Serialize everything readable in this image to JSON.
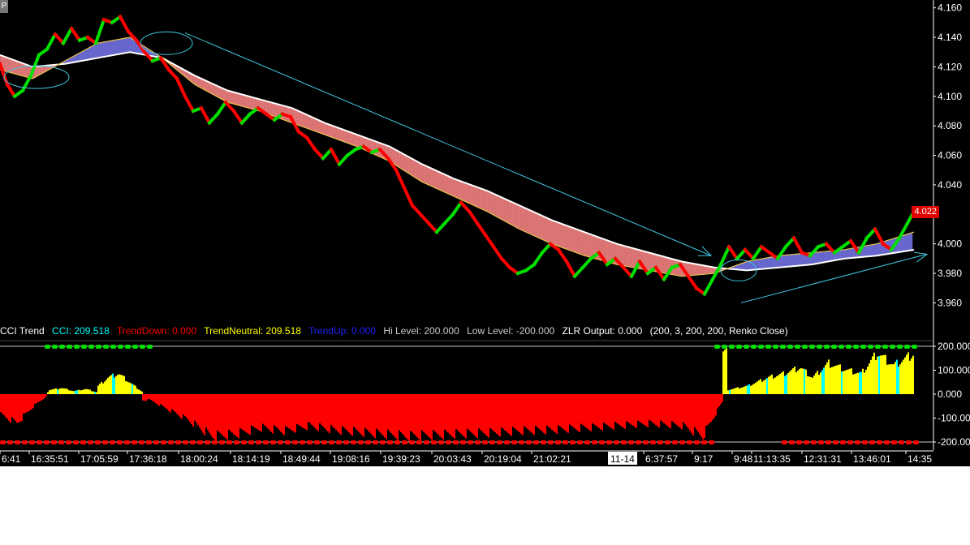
{
  "title_strip": "P",
  "indicator_legend": {
    "name": "CCI Trend",
    "cci": "CCI: 209.518",
    "trend_down": "TrendDown: 0.000",
    "trend_neutral": "TrendNeutral: 209.518",
    "trend_up": "TrendUp: 0.000",
    "hi_level": "Hi Level: 200.000",
    "low_level": "Low Level: -200.000",
    "zlr_output": "ZLR Output: 0.000",
    "params": "(200, 3, 200, 200, Renko Close)"
  },
  "colors": {
    "background": "#000000",
    "up_brick": "#00e000",
    "down_brick": "#ff0000",
    "ribbon_bear": "#f08080",
    "ribbon_bull": "#7070e0",
    "ma_white": "#ffffff",
    "ma_yellow": "#e8c24a",
    "trendline": "#40c8e0",
    "cci_pos": "#ffff00",
    "cci_neg": "#ff0000",
    "cci_cyan": "#00ffff"
  },
  "chart_data": [
    {
      "type": "line",
      "subtype": "renko",
      "x_tick_labels": [
        "6:41",
        "16:35:51",
        "17:05:59",
        "17:36:18",
        "18:00:24",
        "18:14:19",
        "18:49:44",
        "19:08:16",
        "19:39:23",
        "20:03:43",
        "20:19:04",
        "21:02:21",
        "11-14",
        "6:37:57",
        "9:17",
        "9:48",
        "11:13:35",
        "12:31:31",
        "13:46:01",
        "14:35"
      ],
      "y_tick_labels": [
        "4.160",
        "4.140",
        "4.120",
        "4.100",
        "4.080",
        "4.060",
        "4.040",
        "4.022",
        "4.000",
        "3.980",
        "3.960"
      ],
      "ylim": [
        3.952,
        4.162
      ],
      "last_price": "4.022",
      "series": [
        {
          "kind": "renko-close",
          "points": [
            [
              0,
              4.122
            ],
            [
              9,
              4.108
            ],
            [
              18,
              4.1
            ],
            [
              28,
              4.104
            ],
            [
              38,
              4.114
            ],
            [
              48,
              4.128
            ],
            [
              58,
              4.132
            ],
            [
              68,
              4.142
            ],
            [
              78,
              4.136
            ],
            [
              88,
              4.146
            ],
            [
              98,
              4.138
            ],
            [
              108,
              4.14
            ],
            [
              118,
              4.136
            ],
            [
              128,
              4.152
            ],
            [
              138,
              4.15
            ],
            [
              148,
              4.154
            ],
            [
              158,
              4.144
            ],
            [
              168,
              4.138
            ],
            [
              178,
              4.13
            ],
            [
              188,
              4.124
            ],
            [
              198,
              4.126
            ],
            [
              208,
              4.118
            ],
            [
              218,
              4.112
            ],
            [
              228,
              4.1
            ],
            [
              238,
              4.09
            ],
            [
              248,
              4.092
            ],
            [
              258,
              4.082
            ],
            [
              268,
              4.088
            ],
            [
              278,
              4.096
            ],
            [
              288,
              4.09
            ],
            [
              298,
              4.082
            ],
            [
              308,
              4.088
            ],
            [
              318,
              4.092
            ],
            [
              328,
              4.088
            ],
            [
              338,
              4.084
            ],
            [
              348,
              4.088
            ],
            [
              358,
              4.086
            ],
            [
              368,
              4.076
            ],
            [
              378,
              4.072
            ],
            [
              388,
              4.064
            ],
            [
              398,
              4.058
            ],
            [
              408,
              4.064
            ],
            [
              418,
              4.054
            ],
            [
              428,
              4.06
            ],
            [
              438,
              4.064
            ],
            [
              448,
              4.066
            ],
            [
              458,
              4.062
            ],
            [
              468,
              4.064
            ],
            [
              478,
              4.058
            ],
            [
              488,
              4.05
            ],
            [
              498,
              4.038
            ],
            [
              508,
              4.026
            ],
            [
              518,
              4.02
            ],
            [
              528,
              4.014
            ],
            [
              538,
              4.008
            ],
            [
              548,
              4.014
            ],
            [
              558,
              4.02
            ],
            [
              568,
              4.028
            ],
            [
              578,
              4.022
            ],
            [
              588,
              4.014
            ],
            [
              598,
              4.006
            ],
            [
              608,
              3.998
            ],
            [
              618,
              3.99
            ],
            [
              628,
              3.984
            ],
            [
              638,
              3.98
            ],
            [
              648,
              3.982
            ],
            [
              658,
              3.986
            ],
            [
              668,
              3.994
            ],
            [
              678,
              4.0
            ],
            [
              688,
              3.996
            ],
            [
              698,
              3.988
            ],
            [
              708,
              3.978
            ],
            [
              718,
              3.984
            ],
            [
              728,
              3.99
            ],
            [
              738,
              3.994
            ],
            [
              748,
              3.986
            ],
            [
              758,
              3.99
            ],
            [
              768,
              3.984
            ],
            [
              778,
              3.978
            ],
            [
              788,
              3.988
            ],
            [
              798,
              3.98
            ],
            [
              808,
              3.984
            ],
            [
              818,
              3.976
            ],
            [
              828,
              3.984
            ],
            [
              838,
              3.986
            ],
            [
              848,
              3.978
            ],
            [
              858,
              3.97
            ],
            [
              868,
              3.966
            ],
            [
              878,
              3.976
            ],
            [
              888,
              3.986
            ],
            [
              898,
              3.998
            ],
            [
              908,
              3.99
            ],
            [
              918,
              3.996
            ],
            [
              928,
              3.99
            ],
            [
              938,
              3.998
            ],
            [
              948,
              3.994
            ],
            [
              958,
              3.99
            ],
            [
              968,
              3.998
            ],
            [
              978,
              4.004
            ],
            [
              988,
              3.994
            ],
            [
              998,
              3.992
            ],
            [
              1008,
              3.998
            ],
            [
              1018,
              4.0
            ],
            [
              1028,
              3.994
            ],
            [
              1038,
              3.998
            ],
            [
              1048,
              4.002
            ],
            [
              1058,
              3.994
            ],
            [
              1068,
              4.004
            ],
            [
              1078,
              4.01
            ],
            [
              1088,
              4.0
            ],
            [
              1098,
              3.996
            ],
            [
              1108,
              4.004
            ],
            [
              1118,
              4.014
            ],
            [
              1126,
              4.022
            ]
          ]
        },
        {
          "kind": "ma-white",
          "points": [
            [
              0,
              4.128
            ],
            [
              40,
              4.12
            ],
            [
              80,
              4.122
            ],
            [
              120,
              4.126
            ],
            [
              160,
              4.13
            ],
            [
              200,
              4.126
            ],
            [
              240,
              4.114
            ],
            [
              280,
              4.104
            ],
            [
              320,
              4.098
            ],
            [
              360,
              4.092
            ],
            [
              400,
              4.082
            ],
            [
              440,
              4.074
            ],
            [
              480,
              4.066
            ],
            [
              520,
              4.054
            ],
            [
              560,
              4.044
            ],
            [
              600,
              4.036
            ],
            [
              640,
              4.026
            ],
            [
              680,
              4.016
            ],
            [
              720,
              4.008
            ],
            [
              760,
              4.0
            ],
            [
              800,
              3.994
            ],
            [
              840,
              3.988
            ],
            [
              880,
              3.984
            ],
            [
              920,
              3.982
            ],
            [
              960,
              3.984
            ],
            [
              1000,
              3.986
            ],
            [
              1040,
              3.99
            ],
            [
              1080,
              3.992
            ],
            [
              1126,
              3.996
            ]
          ]
        },
        {
          "kind": "ma-fast",
          "points": [
            [
              0,
              4.118
            ],
            [
              40,
              4.112
            ],
            [
              80,
              4.124
            ],
            [
              120,
              4.136
            ],
            [
              160,
              4.14
            ],
            [
              200,
              4.126
            ],
            [
              240,
              4.108
            ],
            [
              280,
              4.096
            ],
            [
              320,
              4.09
            ],
            [
              360,
              4.082
            ],
            [
              400,
              4.074
            ],
            [
              440,
              4.066
            ],
            [
              480,
              4.056
            ],
            [
              520,
              4.042
            ],
            [
              560,
              4.032
            ],
            [
              600,
              4.022
            ],
            [
              640,
              4.01
            ],
            [
              680,
              4.0
            ],
            [
              720,
              3.992
            ],
            [
              760,
              3.986
            ],
            [
              800,
              3.982
            ],
            [
              840,
              3.978
            ],
            [
              880,
              3.98
            ],
            [
              920,
              3.988
            ],
            [
              960,
              3.992
            ],
            [
              1000,
              3.994
            ],
            [
              1040,
              3.996
            ],
            [
              1080,
              4.0
            ],
            [
              1126,
              4.008
            ]
          ]
        }
      ],
      "trendlines": [
        {
          "from": [
            228,
            4.143
          ],
          "to": [
            876,
            3.992
          ]
        },
        {
          "from": [
            913,
            3.96
          ],
          "to": [
            1142,
            3.993
          ]
        }
      ]
    },
    {
      "type": "bar",
      "title": "CCI Trend",
      "y_tick_labels": [
        "200.000",
        "100.000",
        "0.000",
        "-100.000",
        "-200.000"
      ],
      "ylim": [
        -210,
        210
      ],
      "x_range": [
        0,
        1126
      ],
      "segments": [
        {
          "x0": 0,
          "x1": 58,
          "kind": "neg",
          "peaks": [
            [
              0,
              -100
            ],
            [
              20,
              -140
            ],
            [
              40,
              -60
            ],
            [
              58,
              -5
            ]
          ]
        },
        {
          "x0": 58,
          "x1": 118,
          "kind": "pos",
          "peaks": [
            [
              60,
              20
            ],
            [
              75,
              30
            ],
            [
              90,
              15
            ],
            [
              105,
              25
            ],
            [
              118,
              10
            ]
          ]
        },
        {
          "x0": 118,
          "x1": 175,
          "kind": "pos",
          "peaks": [
            [
              120,
              40
            ],
            [
              132,
              80
            ],
            [
              145,
              100
            ],
            [
              158,
              60
            ],
            [
              168,
              30
            ],
            [
              175,
              10
            ]
          ]
        },
        {
          "x0": 175,
          "x1": 890,
          "kind": "neg",
          "peaks": [
            [
              180,
              -20
            ],
            [
              200,
              -60
            ],
            [
              230,
              -120
            ],
            [
              260,
              -200
            ],
            [
              290,
              -190
            ],
            [
              320,
              -160
            ],
            [
              350,
              -175
            ],
            [
              380,
              -150
            ],
            [
              410,
              -170
            ],
            [
              440,
              -180
            ],
            [
              470,
              -190
            ],
            [
              500,
              -200
            ],
            [
              530,
              -195
            ],
            [
              560,
              -190
            ],
            [
              600,
              -185
            ],
            [
              640,
              -175
            ],
            [
              680,
              -170
            ],
            [
              720,
              -160
            ],
            [
              760,
              -150
            ],
            [
              800,
              -140
            ],
            [
              840,
              -150
            ],
            [
              865,
              -200
            ],
            [
              890,
              -30
            ]
          ]
        },
        {
          "x0": 890,
          "x1": 1126,
          "kind": "pos",
          "peaks": [
            [
              895,
              20
            ],
            [
              920,
              40
            ],
            [
              945,
              80
            ],
            [
              965,
              100
            ],
            [
              985,
              130
            ],
            [
              1000,
              80
            ],
            [
              1020,
              150
            ],
            [
              1040,
              120
            ],
            [
              1060,
              100
            ],
            [
              1080,
              200
            ],
            [
              1100,
              140
            ],
            [
              1126,
              200
            ]
          ]
        }
      ],
      "markers_hi": [
        [
          55,
          185
        ],
        [
          880,
          1126
        ]
      ],
      "markers_lo": [
        [
          0,
          1126
        ]
      ]
    }
  ]
}
